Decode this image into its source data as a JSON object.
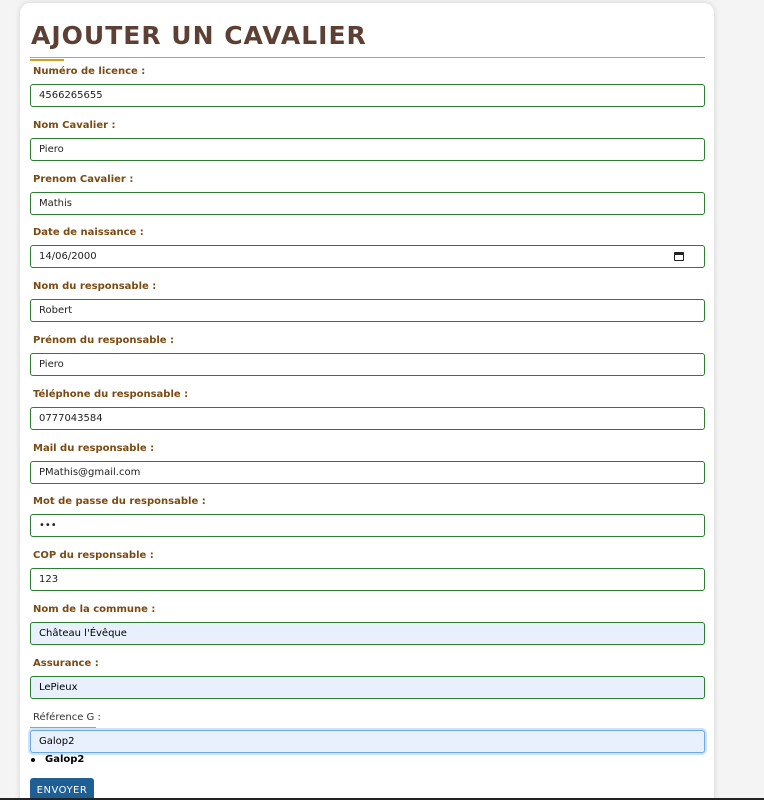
{
  "form": {
    "title": "AJOUTER UN CAVALIER",
    "fields": [
      {
        "label": "Numéro de licence :",
        "value": "4566265655",
        "name": "license-number"
      },
      {
        "label": "Nom Cavalier :",
        "value": "Piero",
        "name": "rider-last-name"
      },
      {
        "label": "Prenom Cavalier :",
        "value": "Mathis",
        "name": "rider-first-name"
      },
      {
        "label": "Date de naissance :",
        "value": "14/06/2000",
        "name": "birth-date"
      },
      {
        "label": "Nom du responsable :",
        "value": "Robert",
        "name": "guardian-last-name"
      },
      {
        "label": "Prénom du responsable :",
        "value": "Piero",
        "name": "guardian-first-name"
      },
      {
        "label": "Téléphone du responsable :",
        "value": "0777043584",
        "name": "guardian-phone"
      },
      {
        "label": "Mail du responsable :",
        "value": "PMathis@gmail.com",
        "name": "guardian-email"
      },
      {
        "label": "Mot de passe du responsable :",
        "value": "•••",
        "name": "guardian-password"
      },
      {
        "label": "COP du responsable :",
        "value": "123",
        "name": "guardian-postal-code"
      },
      {
        "label": "Nom de la commune :",
        "value": "Château l'Évêque",
        "name": "commune-name"
      },
      {
        "label": "Assurance :",
        "value": "LePieux",
        "name": "insurance"
      },
      {
        "label": "Référence G :",
        "value": "Galop2",
        "name": "galop-reference"
      }
    ],
    "suggestions": [
      "Galop2"
    ],
    "submit_label": "ENVOYER"
  },
  "colors": {
    "title": "#5c4033",
    "label": "#7b4a12",
    "input_border": "#2e7d32",
    "accent": "#d4a017",
    "button": "#1f5f94",
    "autofill_bg": "#e8f0fe"
  }
}
